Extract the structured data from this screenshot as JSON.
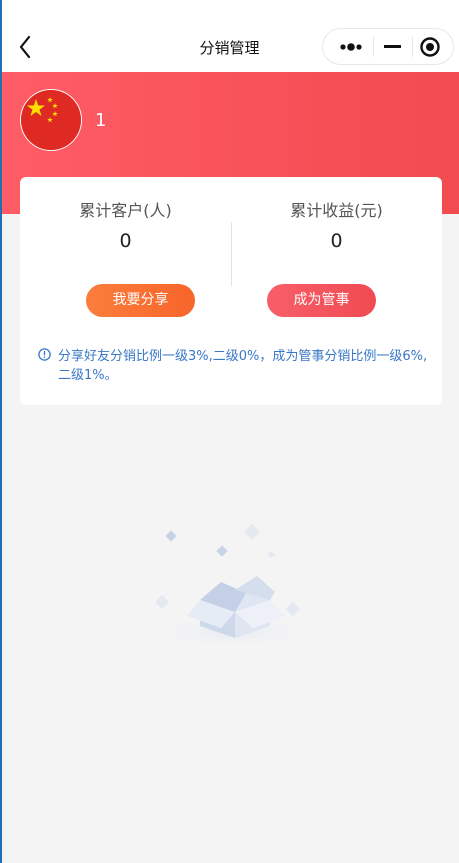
{
  "navbar": {
    "title": "分销管理",
    "back_icon": "chevron-left-icon",
    "more_icon": "more-dots-icon",
    "minimize_icon": "minimize-icon",
    "close_icon": "target-close-icon"
  },
  "header": {
    "avatar_icon": "china-flag-avatar",
    "username": "1",
    "gradient_colors": [
      "#ff5c66",
      "#f24b50"
    ]
  },
  "stats": {
    "customers_label": "累计客户(人)",
    "customers_value": "0",
    "earnings_label": "累计收益(元)",
    "earnings_value": "0"
  },
  "actions": {
    "share_label": "我要分享",
    "become_manager_label": "成为管事"
  },
  "notice": {
    "icon": "info-circle-icon",
    "text": "分享好友分销比例一级3%,二级0%，成为管事分销比例一级6%,二级1%。"
  },
  "empty_state": {
    "icon": "empty-box-icon"
  },
  "colors": {
    "accent_red": "#f24b50",
    "accent_orange": "#f7652a",
    "info_blue": "#3a78c8"
  }
}
